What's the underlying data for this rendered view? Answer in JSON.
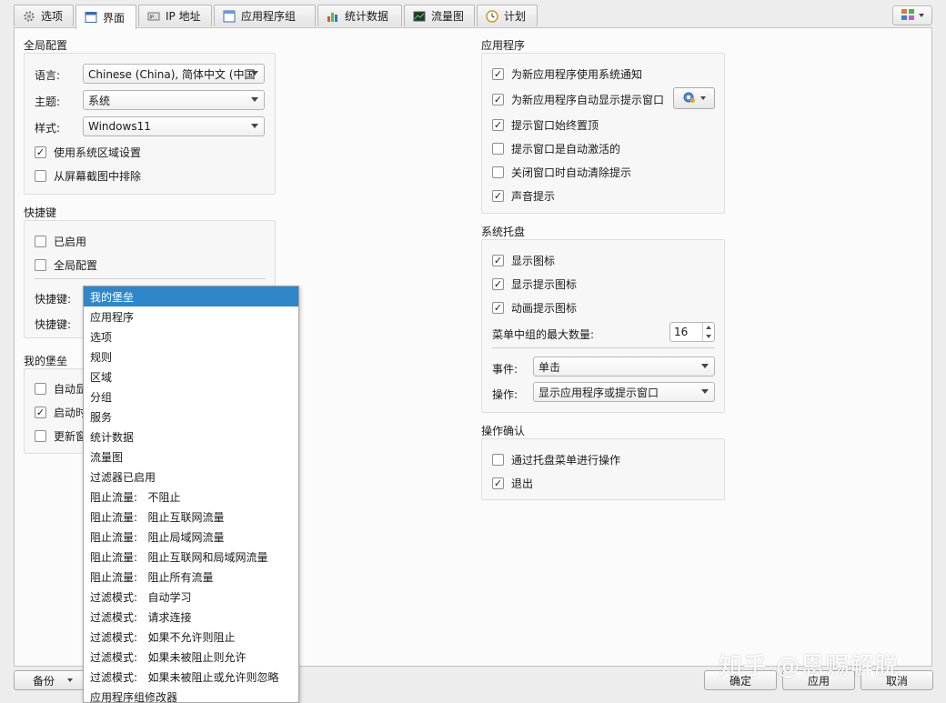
{
  "tabs": [
    {
      "label": "选项",
      "icon": "gear-icon",
      "active": false
    },
    {
      "label": "界面",
      "icon": "window-icon",
      "active": true
    },
    {
      "label": "IP 地址",
      "icon": "ip-icon",
      "active": false
    },
    {
      "label": "应用程序组",
      "icon": "app-group-icon",
      "active": false
    },
    {
      "label": "统计数据",
      "icon": "bar-chart-icon",
      "active": false
    },
    {
      "label": "流量图",
      "icon": "graph-icon",
      "active": false
    },
    {
      "label": "计划",
      "icon": "clock-icon",
      "active": false
    }
  ],
  "global_config": {
    "title": "全局配置",
    "language_label": "语言:",
    "language_value": "Chinese (China), 简体中文 (中国",
    "theme_label": "主题:",
    "theme_value": "系统",
    "style_label": "样式:",
    "style_value": "Windows11",
    "use_locale": {
      "label": "使用系统区域设置",
      "checked": true
    },
    "exclude_screenshot": {
      "label": "从屏幕截图中排除",
      "checked": false
    }
  },
  "hotkeys": {
    "title": "快捷键",
    "enabled": {
      "label": "已启用",
      "checked": false
    },
    "global": {
      "label": "全局配置",
      "checked": false
    },
    "hotkey_label_1": "快捷键:",
    "hotkey_label_2": "快捷键:"
  },
  "my_fort": {
    "title": "我的堡垒",
    "items": [
      {
        "label": "自动显",
        "checked": false
      },
      {
        "label": "启动时",
        "checked": true
      },
      {
        "label": "更新窗",
        "checked": false
      }
    ]
  },
  "applications": {
    "title": "应用程序",
    "items": [
      {
        "label": "为新应用程序使用系统通知",
        "checked": true
      },
      {
        "label": "为新应用程序自动显示提示窗口",
        "checked": true
      },
      {
        "label": "提示窗口始终置顶",
        "checked": true
      },
      {
        "label": "提示窗口是自动激活的",
        "checked": false
      },
      {
        "label": "关闭窗口时自动清除提示",
        "checked": false
      },
      {
        "label": "声音提示",
        "checked": true
      }
    ]
  },
  "tray": {
    "title": "系统托盘",
    "items": [
      {
        "label": "显示图标",
        "checked": true
      },
      {
        "label": "显示提示图标",
        "checked": true
      },
      {
        "label": "动画提示图标",
        "checked": true
      }
    ],
    "max_groups_label": "菜单中组的最大数量:",
    "max_groups_value": "16",
    "event_label": "事件:",
    "event_value": "单击",
    "action_label": "操作:",
    "action_value": "显示应用程序或提示窗口"
  },
  "confirm": {
    "title": "操作确认",
    "items": [
      {
        "label": "通过托盘菜单进行操作",
        "checked": false
      },
      {
        "label": "退出",
        "checked": true
      }
    ]
  },
  "dropdown": {
    "items": [
      "我的堡垒",
      "应用程序",
      "选项",
      "规则",
      "区域",
      "分组",
      "服务",
      "统计数据",
      "流量图",
      "过滤器已启用",
      "阻止流量:   不阻止",
      "阻止流量:   阻止互联网流量",
      "阻止流量:   阻止局域网流量",
      "阻止流量:   阻止互联网和局域网流量",
      "阻止流量:   阻止所有流量",
      "过滤模式:   自动学习",
      "过滤模式:   请求连接",
      "过滤模式:   如果不允许则阻止",
      "过滤模式:   如果未被阻止则允许",
      "过滤模式:   如果未被阻止或允许则忽略",
      "应用程序组修改器"
    ],
    "selected_index": 0
  },
  "bottom": {
    "backup_label": "备份",
    "ok_label": "确定",
    "apply_label": "应用",
    "cancel_label": "取消"
  },
  "watermark": "知乎 @恩赐解脱",
  "colors": {
    "selection": "#2f86c9"
  }
}
